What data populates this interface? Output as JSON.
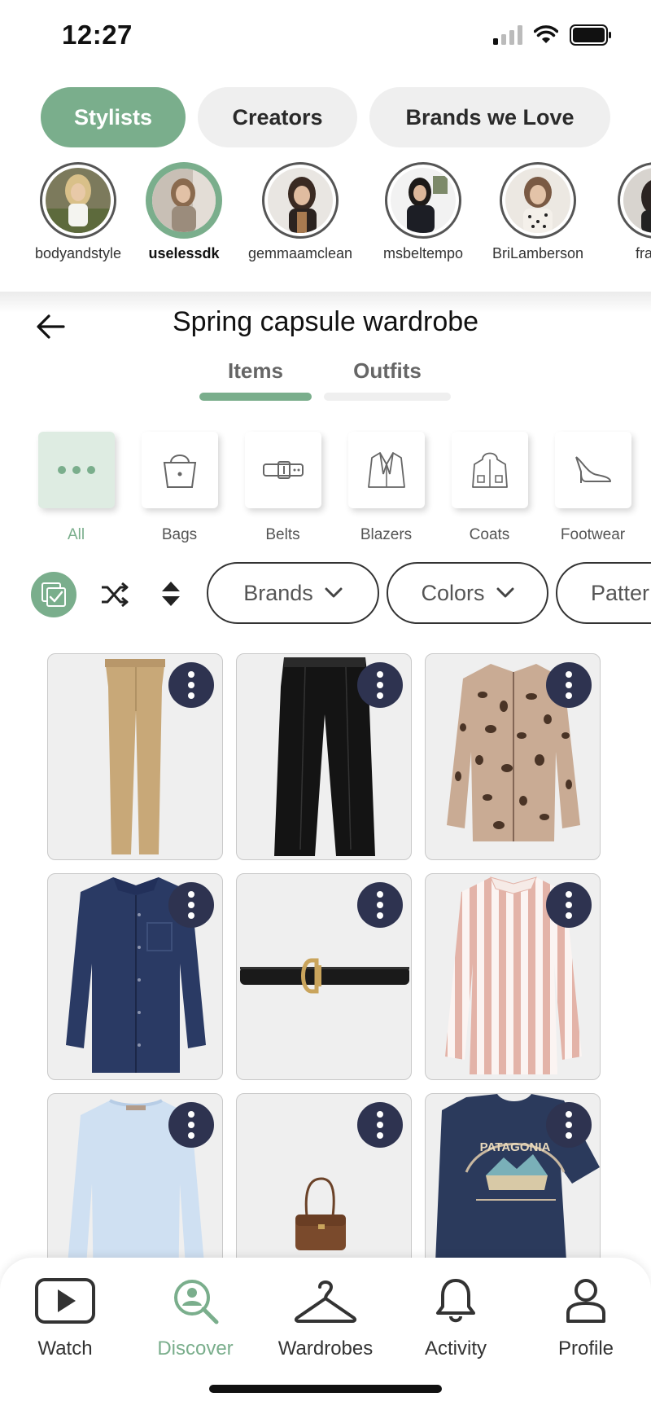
{
  "status": {
    "time": "12:27"
  },
  "segments": [
    {
      "label": "Stylists",
      "active": true
    },
    {
      "label": "Creators",
      "active": false
    },
    {
      "label": "Brands we Love",
      "active": false
    }
  ],
  "stylists": [
    {
      "name": "bodyandstyle",
      "active": false
    },
    {
      "name": "uselessdk",
      "active": true
    },
    {
      "name": "gemmaamclean",
      "active": false
    },
    {
      "name": "msbeltempo",
      "active": false
    },
    {
      "name": "BriLamberson",
      "active": false
    },
    {
      "name": "franim",
      "active": false
    }
  ],
  "page": {
    "title": "Spring capsule wardrobe"
  },
  "tabs": [
    {
      "label": "Items",
      "active": true
    },
    {
      "label": "Outfits",
      "active": false
    }
  ],
  "categories": [
    {
      "label": "All",
      "icon": "more-dots-icon",
      "active": true
    },
    {
      "label": "Bags",
      "icon": "bag-icon",
      "active": false
    },
    {
      "label": "Belts",
      "icon": "belt-icon",
      "active": false
    },
    {
      "label": "Blazers",
      "icon": "blazer-icon",
      "active": false
    },
    {
      "label": "Coats",
      "icon": "coat-icon",
      "active": false
    },
    {
      "label": "Footwear",
      "icon": "heel-icon",
      "active": false
    }
  ],
  "filters": {
    "icons": [
      "select-all-icon",
      "shuffle-icon",
      "sort-icon"
    ],
    "pills": [
      {
        "label": "Brands"
      },
      {
        "label": "Colors"
      },
      {
        "label": "Patter"
      }
    ]
  },
  "items": [
    {
      "name": "beige-trousers"
    },
    {
      "name": "black-wide-trousers"
    },
    {
      "name": "leopard-print-blouse"
    },
    {
      "name": "denim-shirt"
    },
    {
      "name": "black-leather-belt"
    },
    {
      "name": "pink-striped-shirt"
    },
    {
      "name": "light-blue-sweater"
    },
    {
      "name": "brown-shoulder-bag"
    },
    {
      "name": "navy-graphic-tshirt",
      "print_text": "PATAGONIA"
    }
  ],
  "nav": [
    {
      "label": "Watch",
      "icon": "play-icon",
      "active": false
    },
    {
      "label": "Discover",
      "icon": "discover-search-icon",
      "active": true
    },
    {
      "label": "Wardrobes",
      "icon": "hanger-icon",
      "active": false
    },
    {
      "label": "Activity",
      "icon": "bell-icon",
      "active": false
    },
    {
      "label": "Profile",
      "icon": "person-icon",
      "active": false
    }
  ],
  "colors": {
    "accent": "#7aae8c",
    "accent_light": "#deece2",
    "more_button": "#2e3350",
    "card_bg": "#efefef"
  }
}
